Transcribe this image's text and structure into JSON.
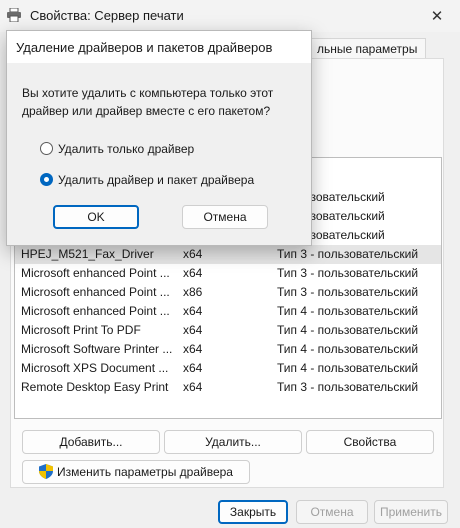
{
  "window": {
    "title": "Свойства: Сервер печати",
    "close_glyph": "✕"
  },
  "tabs": {
    "advanced_partial": "льные параметры"
  },
  "drivers": [
    {
      "name": "",
      "env": "",
      "type": "- пользовательский"
    },
    {
      "name": "",
      "env": "",
      "type": "- пользовательский"
    },
    {
      "name": "",
      "env": "",
      "type": "- пользовательский"
    },
    {
      "name": "HPEJ_M521_Fax_Driver",
      "env": "x64",
      "type": "Тип 3 - пользовательский"
    },
    {
      "name": "Microsoft enhanced Point ...",
      "env": "x64",
      "type": "Тип 3 - пользовательский"
    },
    {
      "name": "Microsoft enhanced Point ...",
      "env": "x86",
      "type": "Тип 3 - пользовательский"
    },
    {
      "name": "Microsoft enhanced Point ...",
      "env": "x64",
      "type": "Тип 4 - пользовательский"
    },
    {
      "name": "Microsoft Print To PDF",
      "env": "x64",
      "type": "Тип 4 - пользовательский"
    },
    {
      "name": "Microsoft Software Printer ...",
      "env": "x64",
      "type": "Тип 4 - пользовательский"
    },
    {
      "name": "Microsoft XPS Document ...",
      "env": "x64",
      "type": "Тип 4 - пользовательский"
    },
    {
      "name": "Remote Desktop Easy Print",
      "env": "x64",
      "type": "Тип 3 - пользовательский"
    }
  ],
  "buttons": {
    "add": "Добавить...",
    "remove": "Удалить...",
    "properties": "Свойства",
    "change_settings": "Изменить параметры драйвера",
    "close": "Закрыть",
    "cancel": "Отмена",
    "apply": "Применить"
  },
  "dialog": {
    "title": "Удаление драйверов и пакетов драйверов",
    "question": "Вы хотите удалить с компьютера только этот\nдрайвер или драйвер вместе с его пакетом?",
    "option_driver_only": "Удалить только драйвер",
    "option_driver_and_package": "Удалить драйвер и пакет драйвера",
    "selected_option": "option_driver_and_package",
    "ok": "OK",
    "cancel": "Отмена"
  },
  "colors": {
    "accent": "#0067c0",
    "selected_row": "#e5e5e5"
  },
  "icons": {
    "title": "printer-icon",
    "close": "close-icon",
    "uac": "uac-shield-icon"
  }
}
